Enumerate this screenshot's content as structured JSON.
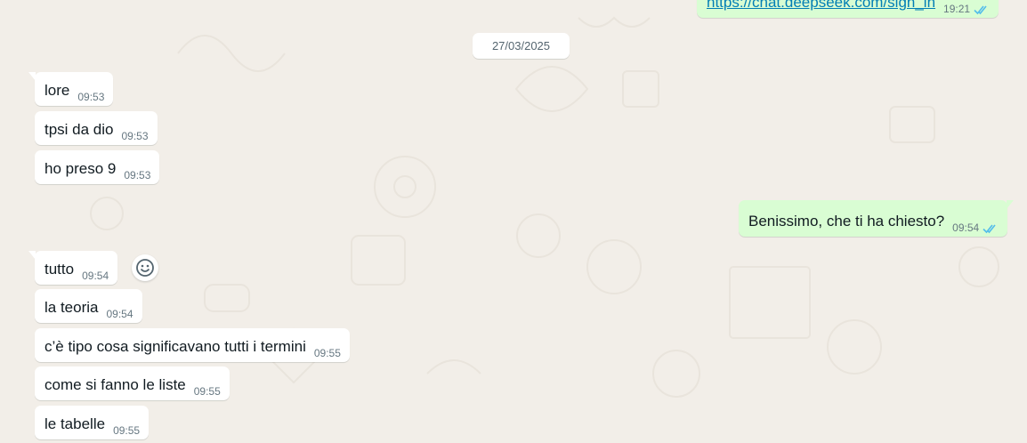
{
  "colors": {
    "background": "#efeae2",
    "incoming_bubble": "#ffffff",
    "outgoing_bubble": "#d9fdd3",
    "read_ticks": "#53bdeb",
    "time_text": "#667781"
  },
  "top_message": {
    "text": "https://chat.deepseek.com/sign_in",
    "time": "19:21",
    "status": "read"
  },
  "date_divider": "27/03/2025",
  "messages": [
    {
      "direction": "in",
      "text": "lore",
      "time": "09:53"
    },
    {
      "direction": "in",
      "text": "tpsi da dio",
      "time": "09:53"
    },
    {
      "direction": "in",
      "text": "ho preso 9",
      "time": "09:53"
    },
    {
      "direction": "out",
      "text": "Benissimo, che ti ha chiesto?",
      "time": "09:54",
      "status": "read"
    },
    {
      "direction": "in",
      "text": "tutto",
      "time": "09:54"
    },
    {
      "direction": "in",
      "text": "la teoria",
      "time": "09:54"
    },
    {
      "direction": "in",
      "text": "c’è tipo cosa significavano tutti i termini",
      "time": "09:55"
    },
    {
      "direction": "in",
      "text": "come si fanno le liste",
      "time": "09:55"
    },
    {
      "direction": "in",
      "text": "le tabelle",
      "time": "09:55"
    }
  ],
  "icons": {
    "emoji_reaction": "smiley-icon",
    "read_receipt": "double-check-icon"
  }
}
